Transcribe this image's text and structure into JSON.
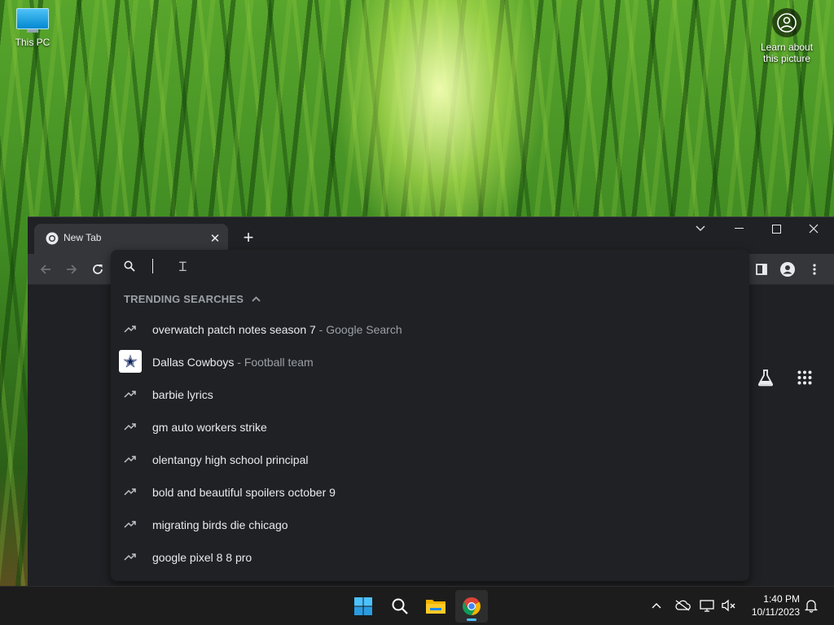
{
  "desktop": {
    "icon_this_pc": "This PC",
    "learn_line1": "Learn about",
    "learn_line2": "this picture"
  },
  "browser": {
    "tab_title": "New Tab",
    "omnibox": {
      "value": "",
      "section_header": "TRENDING SEARCHES",
      "suggestions": [
        {
          "text": "overwatch patch notes season 7",
          "description": " - Google Search",
          "icon": "trending-icon"
        },
        {
          "text": "Dallas Cowboys",
          "description": " - Football team",
          "icon": "dallas-cowboys-logo"
        },
        {
          "text": "barbie lyrics",
          "description": "",
          "icon": "trending-icon"
        },
        {
          "text": "gm auto workers strike",
          "description": "",
          "icon": "trending-icon"
        },
        {
          "text": "olentangy high school principal",
          "description": "",
          "icon": "trending-icon"
        },
        {
          "text": "bold and beautiful spoilers october 9",
          "description": "",
          "icon": "trending-icon"
        },
        {
          "text": "migrating birds die chicago",
          "description": "",
          "icon": "trending-icon"
        },
        {
          "text": "google pixel 8 8 pro",
          "description": "",
          "icon": "trending-icon"
        }
      ]
    }
  },
  "taskbar": {
    "time": "1:40 PM",
    "date": "10/11/2023"
  },
  "colors": {
    "accent": "#4cc2ff",
    "chrome_dark": "#202124",
    "toolbar": "#35363a",
    "secondary_text": "#9aa0a6"
  }
}
